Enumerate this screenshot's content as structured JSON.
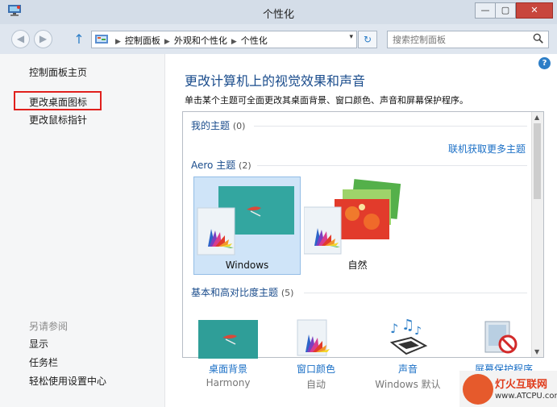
{
  "window": {
    "title": "个性化",
    "min": "—",
    "max": "▢",
    "close": "✕"
  },
  "nav": {
    "back": "◀",
    "forward": "▶",
    "up": "↑",
    "dropdown": "▾",
    "refresh": "↻"
  },
  "address": {
    "crumbs": [
      "控制面板",
      "外观和个性化",
      "个性化"
    ],
    "separator": "▶"
  },
  "search": {
    "placeholder": "搜索控制面板"
  },
  "sidebar": {
    "home": "控制面板主页",
    "items": [
      "更改桌面图标",
      "更改鼠标指针"
    ],
    "see_also": "另请参阅",
    "see_also_items": [
      "显示",
      "任务栏",
      "轻松使用设置中心"
    ]
  },
  "main": {
    "help": "?",
    "heading": "更改计算机上的视觉效果和声音",
    "description": "单击某个主题可全面更改其桌面背景、窗口颜色、声音和屏幕保护程序。",
    "my_themes": {
      "label": "我的主题",
      "count": "(0)"
    },
    "get_more": "联机获取更多主题",
    "aero": {
      "label": "Aero 主题",
      "count": "(2)"
    },
    "themes": [
      {
        "name": "Windows",
        "selected": true
      },
      {
        "name": "自然",
        "selected": false
      }
    ],
    "basic": {
      "label": "基本和高对比度主题",
      "count": "(5)"
    }
  },
  "bottom": [
    {
      "label": "桌面背景",
      "sub": "Harmony",
      "icon": "desktop-background-icon"
    },
    {
      "label": "窗口颜色",
      "sub": "自动",
      "icon": "window-color-icon"
    },
    {
      "label": "声音",
      "sub": "Windows 默认",
      "icon": "sound-icon"
    },
    {
      "label": "屏幕保护程序",
      "sub": "",
      "icon": "screensaver-icon"
    }
  ],
  "watermark": {
    "name": "灯火互联网",
    "url": "www.ATCPU.com"
  },
  "colors": {
    "accent": "#1a6fc6",
    "heading": "#1a4c8c",
    "highlight_box": "#e0201d",
    "selected_tile": "#cfe4f8"
  }
}
